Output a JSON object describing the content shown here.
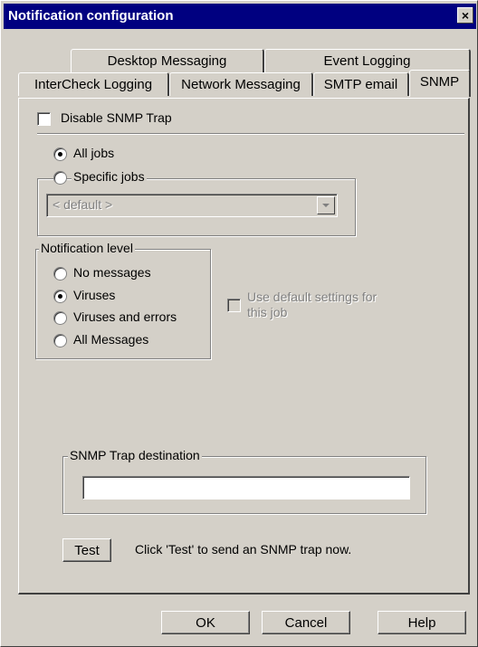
{
  "window": {
    "title": "Notification configuration",
    "close_glyph": "×"
  },
  "tabs": {
    "row_back": [
      "Desktop Messaging",
      "Event Logging"
    ],
    "row_front": [
      "InterCheck Logging",
      "Network Messaging",
      "SMTP email",
      "SNMP"
    ],
    "active": "SNMP"
  },
  "snmp": {
    "disable_trap_label": "Disable SNMP Trap",
    "all_jobs_label": "All jobs",
    "specific_jobs_label": "Specific jobs",
    "job_select_value": "< default >",
    "notification_level": {
      "legend": "Notification level",
      "options": [
        "No messages",
        "Viruses",
        "Viruses and errors",
        "All Messages"
      ],
      "selected": "Viruses"
    },
    "use_default_label_line1": "Use default settings for",
    "use_default_label_line2": "this job",
    "trap_destination": {
      "legend": "SNMP Trap destination",
      "value": ""
    },
    "test_button_label": "Test",
    "test_hint": "Click 'Test' to send an SNMP trap now."
  },
  "footer": {
    "ok_label": "OK",
    "cancel_label": "Cancel",
    "help_label": "Help"
  }
}
